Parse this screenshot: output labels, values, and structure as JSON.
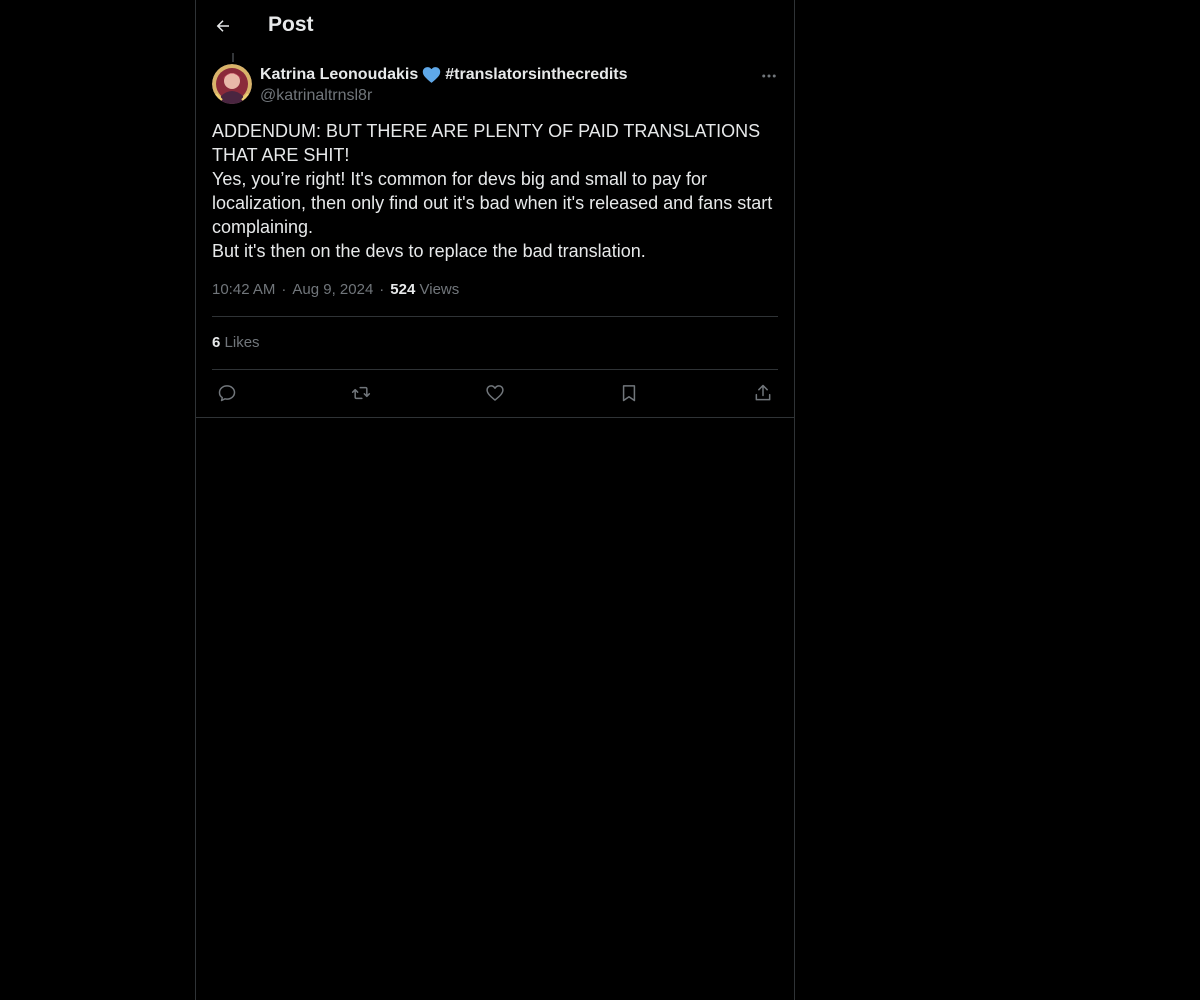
{
  "header": {
    "title": "Post",
    "back_icon": "arrow-left-icon"
  },
  "post": {
    "author": {
      "name": "Katrina Leonoudakis",
      "badge_icon": "blue-heart-icon",
      "hashtag": "#translatorsinthecredits",
      "handle": "@katrinaltrnsl8r"
    },
    "more_icon": "more-horizontal-icon",
    "paragraphs": [
      "ADDENDUM: BUT THERE ARE PLENTY OF PAID TRANSLATIONS THAT ARE SHIT!",
      "Yes, you’re right! It's common for devs big and small to pay for localization, then only find out it's bad when it's released and fans start complaining.",
      "But it's then on the devs to replace the bad translation."
    ],
    "time": "10:42 AM",
    "separator": "·",
    "date": "Aug 9, 2024",
    "views_count": "524",
    "views_label": "Views",
    "likes_count": "6",
    "likes_label": "Likes"
  },
  "actions": {
    "reply_icon": "reply-icon",
    "repost_icon": "repost-icon",
    "like_icon": "heart-icon",
    "bookmark_icon": "bookmark-icon",
    "share_icon": "share-icon"
  },
  "colors": {
    "background": "#000000",
    "text": "#e7e9ea",
    "muted": "#71767b",
    "border": "#2f3336",
    "heart_badge": "#5fa8e8"
  }
}
